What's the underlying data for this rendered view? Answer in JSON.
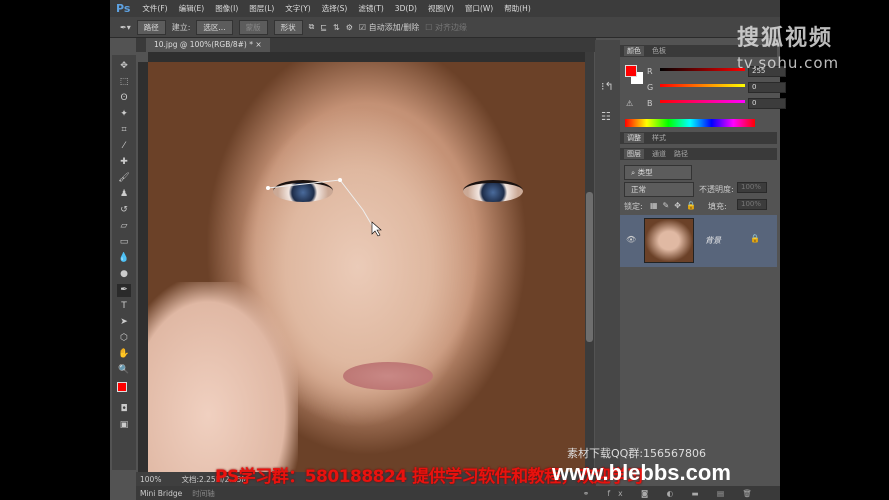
{
  "app": {
    "logo": "Ps"
  },
  "menu": [
    "文件(F)",
    "编辑(E)",
    "图像(I)",
    "图层(L)",
    "文字(Y)",
    "选择(S)",
    "滤镜(T)",
    "3D(D)",
    "视图(V)",
    "窗口(W)",
    "帮助(H)"
  ],
  "options": {
    "mode": "路径",
    "build_label": "建立:",
    "selection_btn": "选区...",
    "mask_btn": "蒙版",
    "shape_btn": "形状",
    "auto_add_delete": "自动添加/删除",
    "align_edges": "对齐边缘"
  },
  "document": {
    "tab": "10.jpg @ 100%(RGB/8#) *",
    "zoom": "100%",
    "doc_info": "文档:2.25M/2.25M"
  },
  "colors": {
    "foreground": "#ff0000",
    "background": "#ffffff"
  },
  "color_panel": {
    "tabs": [
      "颜色",
      "色板"
    ],
    "r_label": "R",
    "g_label": "G",
    "b_label": "B",
    "r": "255",
    "g": "0",
    "b": "0"
  },
  "adjust_panel": {
    "tabs": [
      "调整",
      "样式"
    ]
  },
  "layers_panel": {
    "tabs": [
      "图层",
      "通道",
      "路径"
    ],
    "filter": "类型",
    "blend_mode": "正常",
    "opacity_label": "不透明度:",
    "opacity": "100%",
    "lock_label": "锁定:",
    "fill_label": "填充:",
    "fill": "100%",
    "layers": [
      {
        "name": "背景",
        "visible": true,
        "locked": true
      }
    ]
  },
  "bottom": {
    "mini_bridge": "Mini Bridge",
    "timeline": "时间轴"
  },
  "overlays": {
    "qq": "素材下载QQ群:156567806",
    "group": "PS学习群：580188824 提供学习软件和教程，欢迎学习",
    "site": "www.blebbs.com",
    "sohu_logo": "搜狐视频",
    "sohu_url": "tv.sohu.com"
  }
}
